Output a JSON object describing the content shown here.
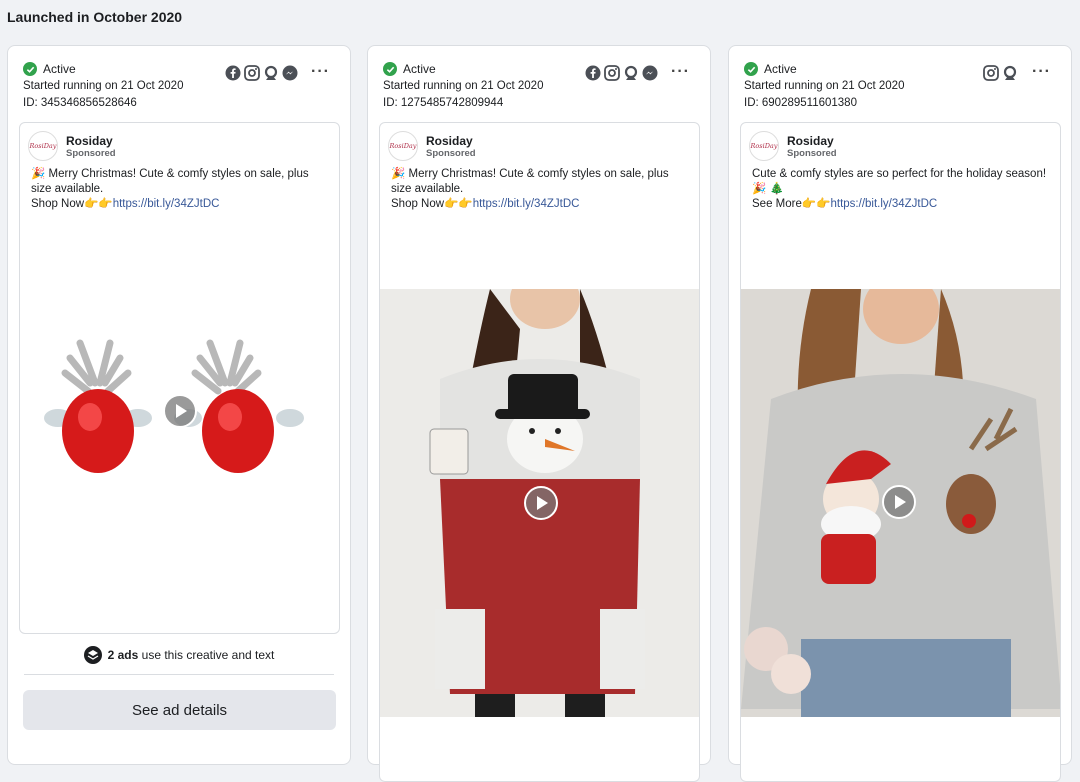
{
  "section": {
    "title": "Launched in October 2020"
  },
  "ads": [
    {
      "status": "Active",
      "started": "Started running on 21 Oct 2020",
      "id": "ID: 345346856528646",
      "platforms": [
        "facebook-icon",
        "instagram-icon",
        "audience-network-icon",
        "messenger-icon"
      ],
      "advertiser": "Rosiday",
      "sponsored": "Sponsored",
      "text_line1": "Merry Christmas! Cute & comfy styles on sale, plus size available.",
      "text_cta": "Shop Now",
      "link": "https://bit.ly/34ZJtDC",
      "ads_count_bold": "2 ads",
      "ads_count_rest": "use this creative and text",
      "details_button": "See ad details"
    },
    {
      "status": "Active",
      "started": "Started running on 21 Oct 2020",
      "id": "ID: 1275485742809944",
      "platforms": [
        "facebook-icon",
        "instagram-icon",
        "audience-network-icon",
        "messenger-icon"
      ],
      "advertiser": "Rosiday",
      "sponsored": "Sponsored",
      "text_line1": "Merry Christmas! Cute & comfy styles on sale, plus size available.",
      "text_cta": "Shop Now",
      "link": "https://bit.ly/34ZJtDC"
    },
    {
      "status": "Active",
      "started": "Started running on 21 Oct 2020",
      "id": "ID: 690289511601380",
      "platforms": [
        "instagram-icon",
        "audience-network-icon"
      ],
      "advertiser": "Rosiday",
      "sponsored": "Sponsored",
      "text_line1": "Cute & comfy styles are so perfect for the holiday season!",
      "text_cta": "See More",
      "link": "https://bit.ly/34ZJtDC"
    }
  ],
  "avatar_text": "RosiDay",
  "colors": {
    "active": "#31a24c",
    "link": "#385898",
    "button_bg": "#e4e6eb"
  }
}
